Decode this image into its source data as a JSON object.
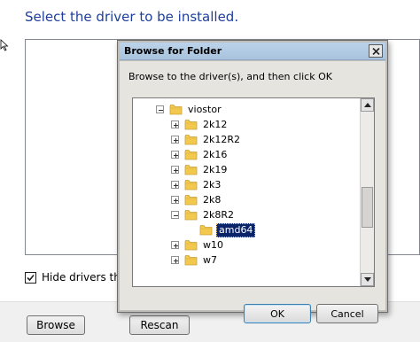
{
  "wizard": {
    "heading": "Select the driver to be installed.",
    "hide_drivers_label": "Hide drivers that a",
    "hide_drivers_checked": true,
    "browse_label": "Browse",
    "rescan_label": "Rescan"
  },
  "dialog": {
    "title": "Browse for Folder",
    "instruction": "Browse to the driver(s), and then click OK",
    "ok_label": "OK",
    "cancel_label": "Cancel",
    "tree": {
      "root": "viostor",
      "children": [
        "2k12",
        "2k12R2",
        "2k16",
        "2k19",
        "2k3",
        "2k8",
        "2k8R2",
        "amd64",
        "w10",
        "w7"
      ],
      "selected": "amd64"
    }
  },
  "icons": {
    "cursor": "mouse-pointer-icon",
    "folder": "folder-icon",
    "check": "checkmark-icon",
    "close": "close-icon"
  },
  "colors": {
    "heading": "#1f3f9a",
    "selection": "#0a246a",
    "folder": "#f2c94c"
  }
}
